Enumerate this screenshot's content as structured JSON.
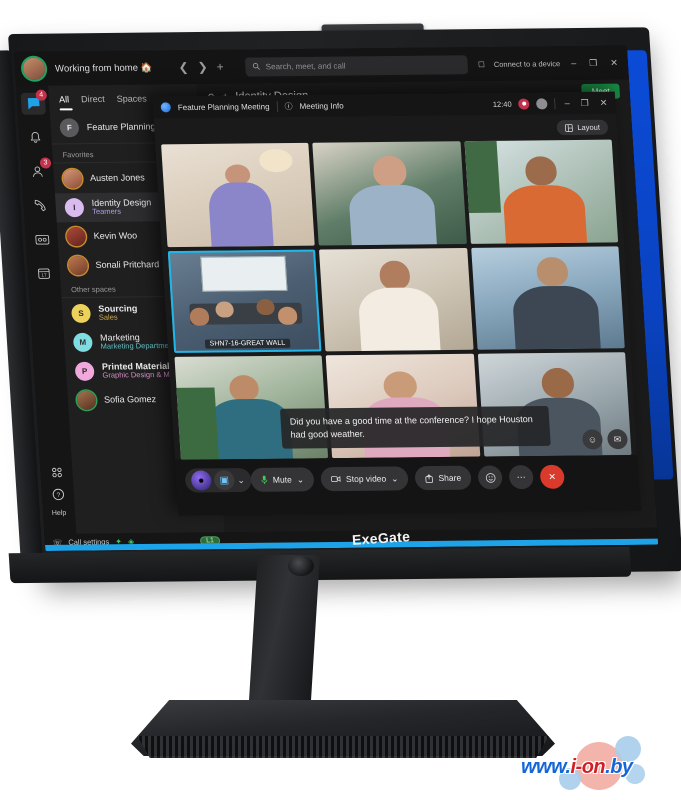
{
  "product": {
    "brand": "ExeGate",
    "watermark": "www.i-on.by",
    "watermark_parts": {
      "www": "www.",
      "ion": "i-on",
      "by": ".by"
    }
  },
  "app": {
    "titlebar": {
      "presence_status": "Working from home",
      "presence_emoji": "🏠",
      "back_icon": "chevron-left-icon",
      "forward_icon": "chevron-right-icon",
      "new_icon": "plus-icon",
      "search_placeholder": "Search, meet, and call",
      "search_value": "",
      "connect_label": "Connect to a device",
      "minimize": "–",
      "maximize": "❐",
      "close": "✕"
    },
    "rail": [
      {
        "name": "chat-icon",
        "glyph": "💬",
        "badge": "4",
        "active": true
      },
      {
        "name": "bell-icon",
        "glyph": "○",
        "badge": "",
        "active": false
      },
      {
        "name": "contacts-icon",
        "glyph": "○",
        "badge": "3",
        "active": false
      },
      {
        "name": "phone-icon",
        "glyph": "✆",
        "badge": "",
        "active": false
      },
      {
        "name": "voicemail-icon",
        "glyph": "□",
        "badge": "",
        "active": false
      },
      {
        "name": "calendar-icon",
        "glyph": "17",
        "badge": "",
        "active": false
      }
    ],
    "rail_bottom": {
      "apps_icon": "apps-grid-icon",
      "help_icon": "question-mark-icon",
      "help_label": "Help"
    },
    "tabs": [
      {
        "label": "All",
        "active": true
      },
      {
        "label": "Direct",
        "active": false
      },
      {
        "label": "Spaces",
        "active": false
      }
    ],
    "filter_icon": "filter-icon",
    "list": {
      "pinned": {
        "initial": "F",
        "name": "Feature Planning M",
        "subtitle": "",
        "color": "#5a5a5c"
      },
      "sections": [
        {
          "title": "Favorites",
          "items": [
            {
              "name": "Austen Jones",
              "subtitle": "",
              "initial": "",
              "color": "#b4704e",
              "photo": true,
              "bold": false
            },
            {
              "name": "Identity Design",
              "subtitle": "Teamers",
              "initial": "I",
              "color": "#d9bbf0",
              "photo": false,
              "bold": false,
              "selected": true,
              "sub_class": "purple"
            },
            {
              "name": "Kevin Woo",
              "subtitle": "",
              "initial": "",
              "color": "#8e3a2e",
              "photo": true,
              "bold": false
            },
            {
              "name": "Sonali Pritchard",
              "subtitle": "",
              "initial": "",
              "color": "#9a5a3a",
              "photo": true,
              "bold": false
            }
          ]
        },
        {
          "title": "Other spaces",
          "items": [
            {
              "name": "Sourcing",
              "subtitle": "Sales",
              "initial": "S",
              "color": "#ecd15a",
              "photo": false,
              "bold": true,
              "sub_class": "yellow"
            },
            {
              "name": "Marketing",
              "subtitle": "Marketing Department",
              "initial": "M",
              "color": "#7fdce0",
              "photo": false,
              "bold": false,
              "sub_class": "teal"
            },
            {
              "name": "Printed Materials",
              "subtitle": "Graphic Design & Mark",
              "initial": "P",
              "color": "#f0a8dd",
              "photo": false,
              "bold": true,
              "sub_class": "pink"
            },
            {
              "name": "Sofia Gomez",
              "subtitle": "",
              "initial": "",
              "color": "#8a6a4a",
              "photo": true,
              "bold": false
            }
          ]
        }
      ]
    },
    "pane": {
      "settings_icon": "gear-icon",
      "star_icon": "star-icon",
      "title": "Identity Design",
      "meet_button": "Meet"
    },
    "statusbar": {
      "phone_icon": "phone-settings-icon",
      "label": "Call settings",
      "icon_a": "network-icon",
      "icon_b": "diamond-icon",
      "line_badge": "L1"
    }
  },
  "meeting": {
    "logo_icon": "meeting-app-icon",
    "title": "Feature Planning Meeting",
    "info_icon": "info-icon",
    "info_label": "Meeting Info",
    "timer": "12:40",
    "recording_icon": "recording-icon",
    "bluetooth_icon": "bluetooth-icon",
    "window_buttons": {
      "minimize": "–",
      "maximize": "❐",
      "close": "✕"
    },
    "layout_button": {
      "icon": "layout-grid-icon",
      "label": "Layout"
    },
    "tiles": [
      {
        "id": 1,
        "label": "",
        "active": false,
        "skin": "ph1"
      },
      {
        "id": 2,
        "label": "",
        "active": false,
        "skin": "ph2"
      },
      {
        "id": 3,
        "label": "",
        "active": false,
        "skin": "ph3"
      },
      {
        "id": 4,
        "label": "SHN7-16-GREAT WALL",
        "active": true,
        "skin": "ph4"
      },
      {
        "id": 5,
        "label": "",
        "active": false,
        "skin": "ph5"
      },
      {
        "id": 6,
        "label": "",
        "active": false,
        "skin": "ph6"
      },
      {
        "id": 7,
        "label": "",
        "active": false,
        "skin": "ph7"
      },
      {
        "id": 8,
        "label": "",
        "active": false,
        "skin": "ph8"
      },
      {
        "id": 9,
        "label": "",
        "active": false,
        "skin": "ph9"
      }
    ],
    "caption": "Did you have a good time at the conference? I hope Houston had good weather.",
    "controls": {
      "mute": {
        "icon": "microphone-icon",
        "label": "Mute",
        "chevron": "⌄"
      },
      "video": {
        "icon": "camera-icon",
        "label": "Stop video",
        "chevron": "⌄"
      },
      "share": {
        "icon": "share-icon",
        "label": "Share"
      },
      "reactions": {
        "icon": "emoji-icon"
      },
      "more": {
        "icon": "more-options-icon",
        "label": "⋯"
      },
      "end_call": {
        "icon": "end-call-icon",
        "label": "✕"
      },
      "participants": {
        "icon": "people-icon"
      },
      "chat": {
        "icon": "chat-bubble-icon"
      },
      "assistant": {
        "icon": "assistant-avatar-icon"
      },
      "effects": {
        "icon": "video-effects-icon",
        "chevron": "⌄"
      }
    }
  },
  "hardware": {
    "webcam_icon": "popup-webcam-icon",
    "stand_icon": "monitor-stand",
    "base_icon": "monitor-base"
  }
}
